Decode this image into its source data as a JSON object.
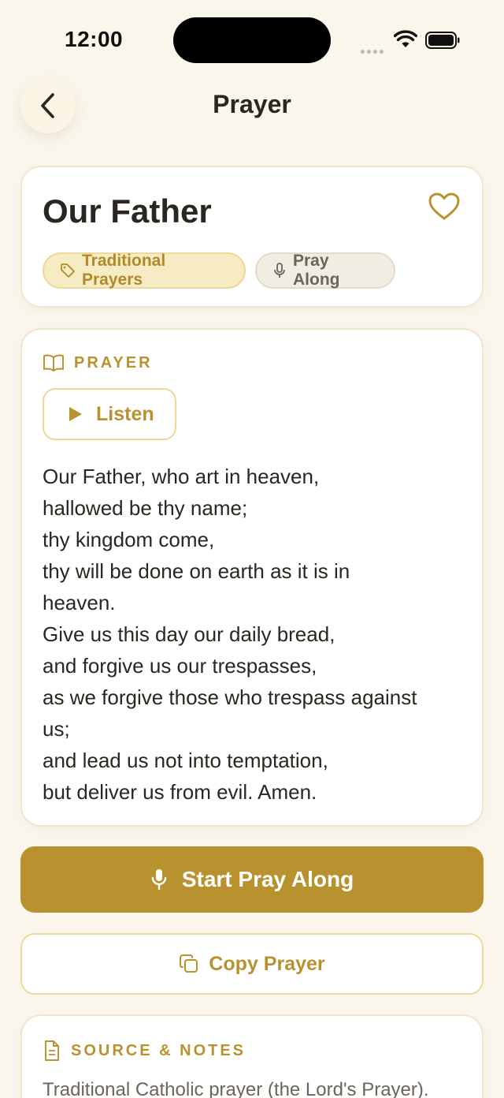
{
  "status_bar": {
    "time": "12:00"
  },
  "header": {
    "title": "Prayer",
    "back_icon": "chevron-left-icon"
  },
  "prayer": {
    "name": "Our Father",
    "favorite_icon": "heart-outline-icon",
    "category_chip": "Traditional Prayers",
    "pray_along_chip": "Pray Along",
    "section_label": "PRAYER",
    "listen_label": "Listen",
    "text": "Our Father, who art in heaven,\nhallowed be thy name;\nthy kingdom come,\nthy will be done on earth as it is in\nheaven.\nGive us this day our daily bread,\nand forgive us our trespasses,\nas we forgive those who trespass against\nus;\nand lead us not into temptation,\nbut deliver us from evil. Amen."
  },
  "actions": {
    "start_pray_along": "Start Pray Along",
    "copy_prayer": "Copy Prayer"
  },
  "notes": {
    "section_label": "SOURCE & NOTES",
    "text": "Traditional Catholic prayer (the Lord's Prayer)."
  },
  "colors": {
    "background": "#faf6ec",
    "accent": "#b8922e",
    "chip_category_bg": "#f7ebc4",
    "chip_neutral_bg": "#f1ede2",
    "text_primary": "#2a2620",
    "text_secondary": "#6b655a"
  }
}
